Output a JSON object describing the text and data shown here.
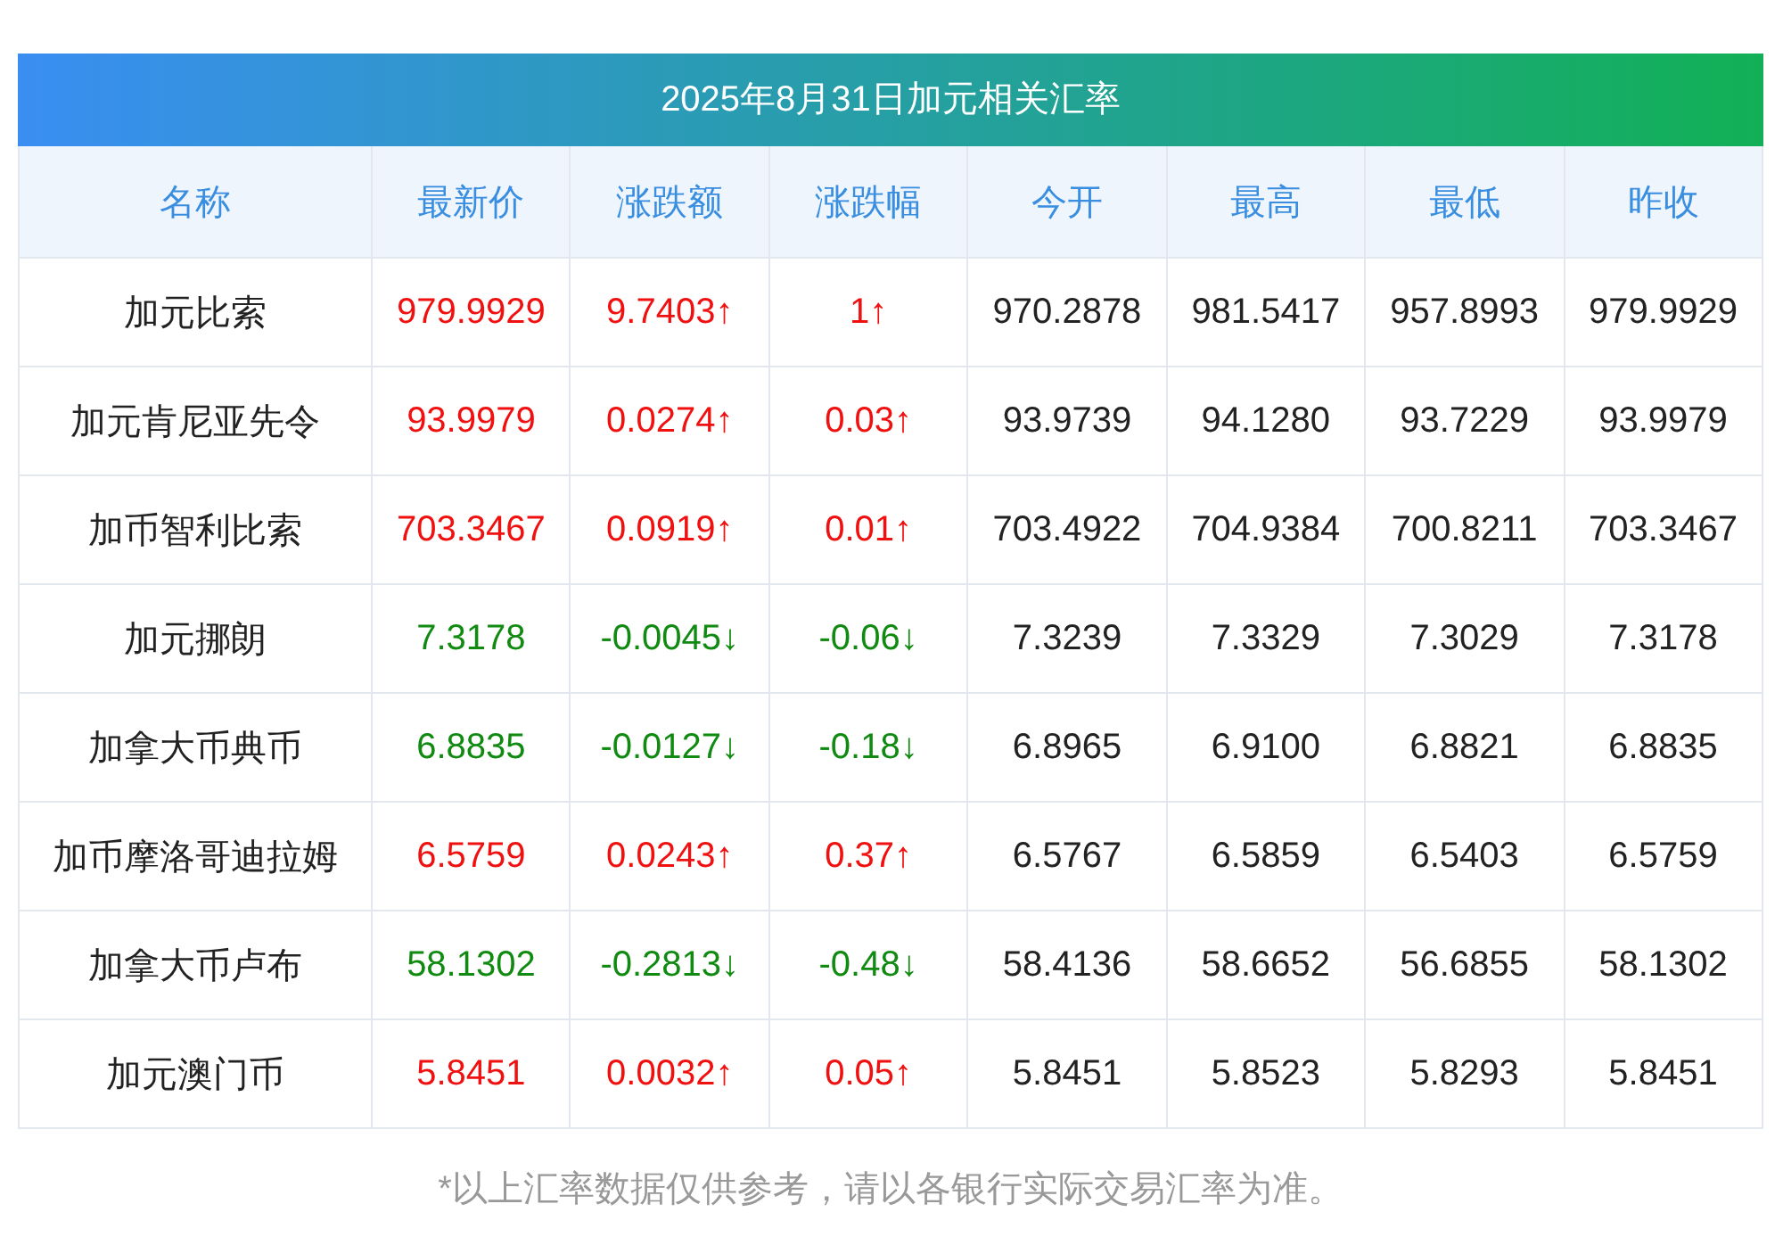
{
  "title": "2025年8月31日加元相关汇率",
  "columns": [
    "名称",
    "最新价",
    "涨跌额",
    "涨跌幅",
    "今开",
    "最高",
    "最低",
    "昨收"
  ],
  "rows": [
    {
      "name": "加元比索",
      "rising": true,
      "price": "979.9929",
      "change": "9.7403↑",
      "pct": "1↑",
      "open": "970.2878",
      "high": "981.5417",
      "low": "957.8993",
      "prev": "979.9929"
    },
    {
      "name": "加元肯尼亚先令",
      "rising": true,
      "price": "93.9979",
      "change": "0.0274↑",
      "pct": "0.03↑",
      "open": "93.9739",
      "high": "94.1280",
      "low": "93.7229",
      "prev": "93.9979"
    },
    {
      "name": "加币智利比索",
      "rising": true,
      "price": "703.3467",
      "change": "0.0919↑",
      "pct": "0.01↑",
      "open": "703.4922",
      "high": "704.9384",
      "low": "700.8211",
      "prev": "703.3467"
    },
    {
      "name": "加元挪朗",
      "rising": false,
      "price": "7.3178",
      "change": "-0.0045↓",
      "pct": "-0.06↓",
      "open": "7.3239",
      "high": "7.3329",
      "low": "7.3029",
      "prev": "7.3178"
    },
    {
      "name": "加拿大币典币",
      "rising": false,
      "price": "6.8835",
      "change": "-0.0127↓",
      "pct": "-0.18↓",
      "open": "6.8965",
      "high": "6.9100",
      "low": "6.8821",
      "prev": "6.8835"
    },
    {
      "name": "加币摩洛哥迪拉姆",
      "rising": true,
      "price": "6.5759",
      "change": "0.0243↑",
      "pct": "0.37↑",
      "open": "6.5767",
      "high": "6.5859",
      "low": "6.5403",
      "prev": "6.5759"
    },
    {
      "name": "加拿大币卢布",
      "rising": false,
      "price": "58.1302",
      "change": "-0.2813↓",
      "pct": "-0.48↓",
      "open": "58.4136",
      "high": "58.6652",
      "low": "56.6855",
      "prev": "58.1302"
    },
    {
      "name": "加元澳门币",
      "rising": true,
      "price": "5.8451",
      "change": "0.0032↑",
      "pct": "0.05↑",
      "open": "5.8451",
      "high": "5.8523",
      "low": "5.8293",
      "prev": "5.8451"
    }
  ],
  "footnote": "*以上汇率数据仅供参考，请以各银行实际交易汇率为准。"
}
